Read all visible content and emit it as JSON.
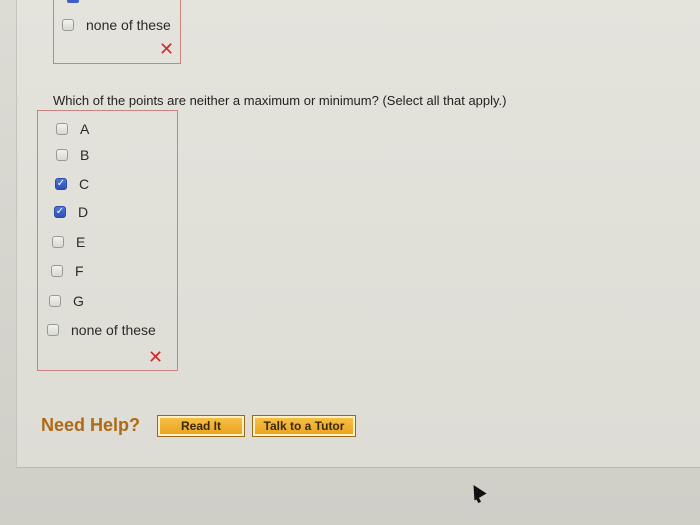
{
  "previous_question": {
    "option_label": "none of these",
    "result": "✕"
  },
  "question": {
    "text": "Which of the points are neither a maximum or minimum? (Select all that apply.)",
    "options": [
      {
        "label": "A",
        "checked": false
      },
      {
        "label": "B",
        "checked": false
      },
      {
        "label": "C",
        "checked": true
      },
      {
        "label": "D",
        "checked": true
      },
      {
        "label": "E",
        "checked": false
      },
      {
        "label": "F",
        "checked": false
      },
      {
        "label": "G",
        "checked": false
      },
      {
        "label": "none of these",
        "checked": false
      }
    ],
    "result": "✕"
  },
  "help": {
    "label": "Need Help?",
    "read_button": "Read It",
    "tutor_button": "Talk to a Tutor"
  },
  "colors": {
    "incorrect": "#d42a2a",
    "checkbox_checked": "#2d50b8",
    "button": "#e9a11c",
    "help_text": "#b06a14"
  }
}
